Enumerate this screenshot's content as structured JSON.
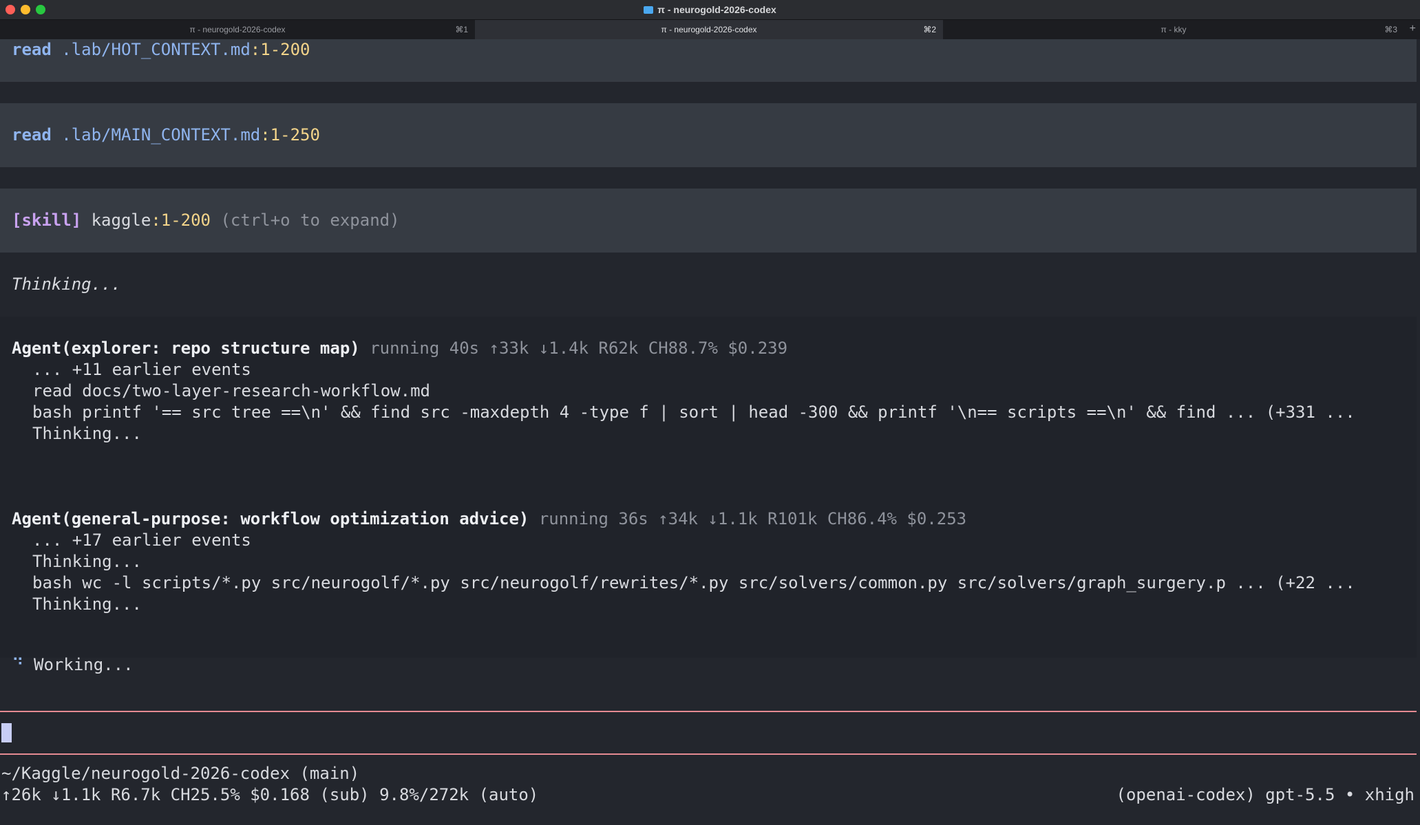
{
  "window": {
    "title": "π - neurogold-2026-codex"
  },
  "tabs": [
    {
      "label": "π - neurogold-2026-codex",
      "shortcut": "⌘1"
    },
    {
      "label": "π - neurogold-2026-codex",
      "shortcut": "⌘2"
    },
    {
      "label": "π - kky",
      "shortcut": "⌘3"
    }
  ],
  "new_tab": "+",
  "tool_calls": [
    {
      "verb": "read",
      "path": ".lab/HOT_CONTEXT.md",
      "range": ":1-200"
    },
    {
      "verb": "read",
      "path": ".lab/MAIN_CONTEXT.md",
      "range": ":1-250"
    },
    {
      "tag": "[skill]",
      "name": "kaggle",
      "range": ":1-200",
      "hint": "(ctrl+o to expand)"
    }
  ],
  "thinking": "Thinking...",
  "agents": [
    {
      "title": "Agent(explorer: repo structure map)",
      "stats": "running 40s ↑33k ↓1.4k R62k CH88.7% $0.239",
      "lines": [
        "... +11 earlier events",
        "read docs/two-layer-research-workflow.md",
        "bash printf '== src tree ==\\n' && find src -maxdepth 4 -type f | sort | head -300 && printf '\\n== scripts ==\\n' && find ... (+331 ...",
        "Thinking..."
      ]
    },
    {
      "title": "Agent(general-purpose: workflow optimization advice)",
      "stats": "running 36s ↑34k ↓1.1k R101k CH86.4% $0.253",
      "lines": [
        "... +17 earlier events",
        "Thinking...",
        "bash wc -l scripts/*.py src/neurogolf/*.py src/neurogolf/rewrites/*.py src/solvers/common.py src/solvers/graph_surgery.p ... (+22 ...",
        "Thinking..."
      ]
    }
  ],
  "working": {
    "spinner": "⠙",
    "text": "Working..."
  },
  "footer": {
    "cwd": "~/Kaggle/neurogold-2026-codex (main)",
    "usage": "↑26k ↓1.1k R6.7k CH25.5% $0.168 (sub) 9.8%/272k (auto)",
    "model": "(openai-codex) gpt-5.5 • xhigh"
  },
  "colors": {
    "accent": "#8fb4ee",
    "range": "#f3d48a",
    "skill": "#c9a2f0",
    "input_border": "#e58a92"
  }
}
